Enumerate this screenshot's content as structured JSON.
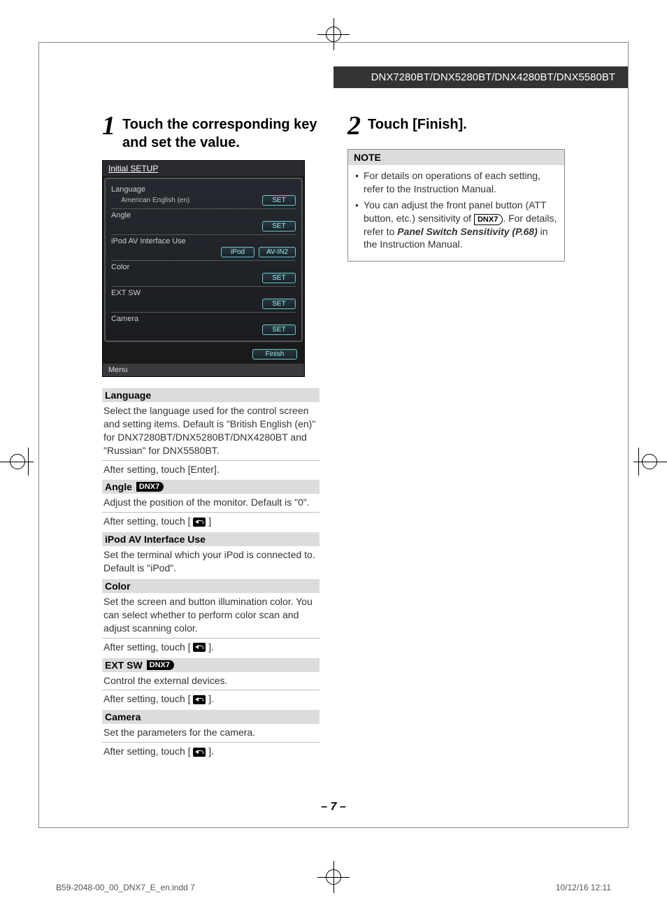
{
  "header": {
    "models": "DNX7280BT/DNX5280BT/DNX4280BT/DNX5580BT"
  },
  "step1": {
    "num": "1",
    "title": "Touch the corresponding key and set the value."
  },
  "step2": {
    "num": "2",
    "title": "Touch [Finish]."
  },
  "screenshot": {
    "title": "Initial SETUP",
    "rows": {
      "language": {
        "label": "Language",
        "value": "American English (en)",
        "btn": "SET"
      },
      "angle": {
        "label": "Angle",
        "btn": "SET"
      },
      "ipod": {
        "label": "iPod AV Interface Use",
        "btn1": "iPod",
        "btn2": "AV-IN2"
      },
      "color": {
        "label": "Color",
        "btn": "SET"
      },
      "extsw": {
        "label": "EXT SW",
        "btn": "SET"
      },
      "camera": {
        "label": "Camera",
        "btn": "SET"
      }
    },
    "finish": "Finish",
    "menu": "Menu"
  },
  "defs": {
    "language": {
      "title": "Language",
      "body": "Select the language used for the control screen and setting items. Default is \"British English (en)\" for DNX7280BT/DNX5280BT/DNX4280BT and \"Russian\" for DNX5580BT.",
      "after": "After setting, touch [Enter]."
    },
    "angle": {
      "title": "Angle",
      "badge": "DNX7",
      "body": "Adjust the position of the monitor. Default is \"0\".",
      "after_prefix": "After setting, touch [ ",
      "after_suffix": " ]"
    },
    "ipod": {
      "title": "iPod AV Interface Use",
      "body": "Set the terminal which your iPod is connected to. Default is \"iPod\"."
    },
    "color": {
      "title": "Color",
      "body": "Set the screen and button illumination color. You can select whether to perform color scan and adjust scanning color.",
      "after_prefix": "After setting, touch [ ",
      "after_suffix": " ]."
    },
    "extsw": {
      "title": "EXT SW",
      "badge": "DNX7",
      "body": "Control the external devices.",
      "after_prefix": "After setting, touch [ ",
      "after_suffix": " ]."
    },
    "camera": {
      "title": "Camera",
      "body": "Set the parameters for the camera.",
      "after_prefix": "After setting, touch [ ",
      "after_suffix": " ]."
    }
  },
  "note": {
    "title": "NOTE",
    "item1": "For details on operations of each setting, refer to the Instruction Manual.",
    "item2_a": "You can adjust the front panel button (ATT button, etc.) sensitivity of ",
    "item2_badge": "DNX7",
    "item2_b": ". For details, refer to ",
    "item2_ref": "Panel Switch Sensitivity (P.68)",
    "item2_c": " in the Instruction Manual."
  },
  "pagenum": "7",
  "footer": {
    "left": "B59-2048-00_00_DNX7_E_en.indd   7",
    "right": "10/12/16   12:11"
  }
}
